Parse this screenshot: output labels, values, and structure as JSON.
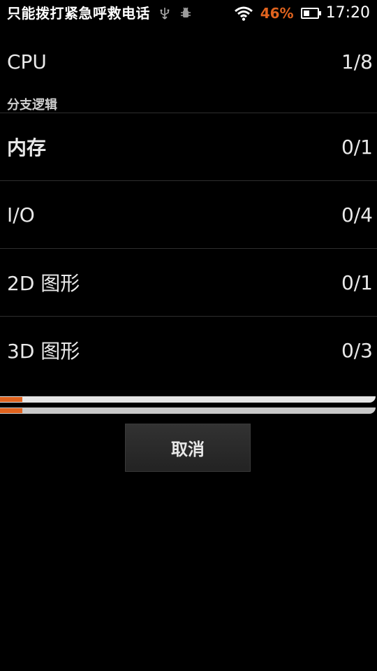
{
  "status_bar": {
    "carrier_text": "只能拨打紧急呼救电话",
    "battery_percent": "46%",
    "battery_level": 0.46,
    "time": "17:20",
    "battery_color": "#e0631e",
    "icons": [
      "usb-icon",
      "debug-icon",
      "wifi-icon",
      "battery-icon"
    ]
  },
  "rows": {
    "cpu": {
      "label": "CPU",
      "value": "1/8"
    },
    "section": "分支逻辑",
    "memory": {
      "label": "内存",
      "value": "0/1"
    },
    "io": {
      "label": "I/O",
      "value": "0/4"
    },
    "graphics2d": {
      "label": "2D 图形",
      "value": "0/1"
    },
    "graphics3d": {
      "label": "3D 图形",
      "value": "0/3"
    }
  },
  "progress": {
    "overall": 0.06,
    "current": 0.06,
    "accent": "#e0631e"
  },
  "cancel_label": "取消"
}
